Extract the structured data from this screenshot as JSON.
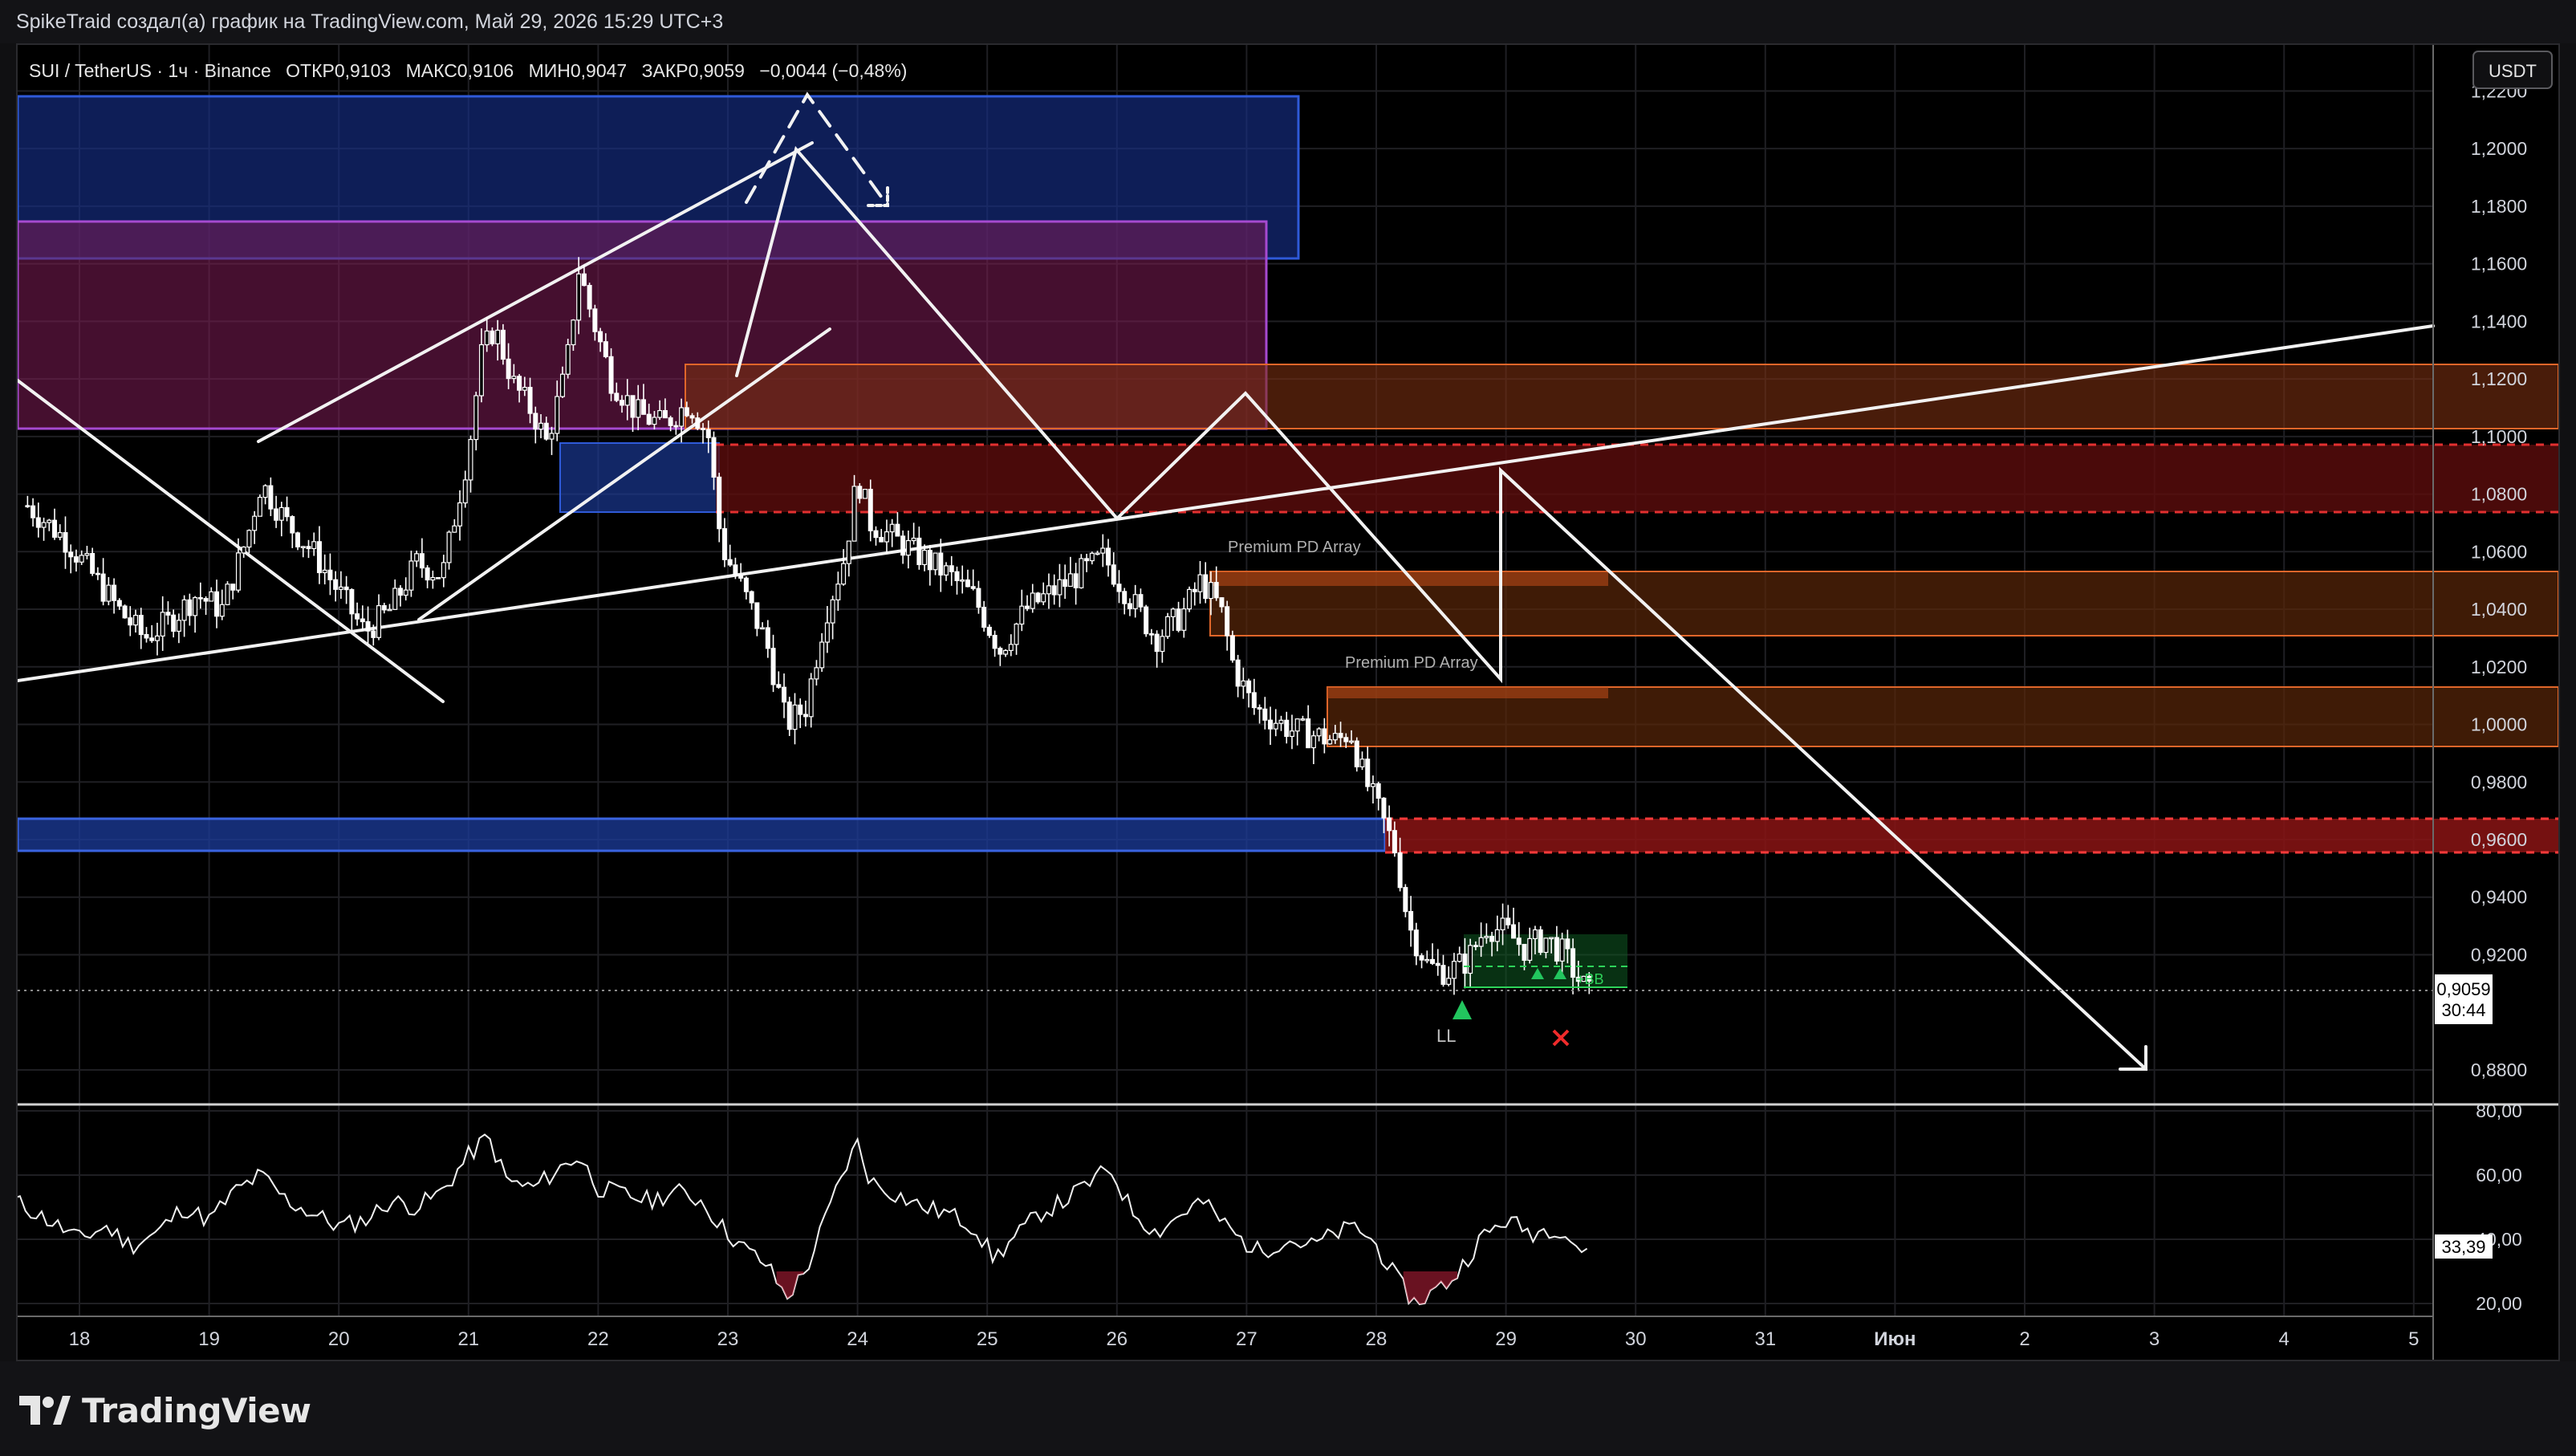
{
  "topbar": {
    "text": "SpikeTraid создал(а) график на TradingView.com, Май 29, 2026 15:29 UTC+3"
  },
  "legend": {
    "symbol": "SUI / TetherUS · 1ч · Binance",
    "open": "ОТКР0,9103",
    "high": "МАКС0,9106",
    "low": "МИН0,9047",
    "close": "ЗАКР0,9059",
    "change": "−0,0044 (−0,48%)"
  },
  "currency_button": "USDT",
  "price_badge": {
    "price": "0,9059",
    "countdown": "30:44"
  },
  "rsi_badge": "33,39",
  "footer": {
    "logo_text": "TradingView"
  },
  "colors": {
    "background": "#000000",
    "grid": "#1f1f23",
    "candle": "#ffffff",
    "blue_zone": "#2850d0",
    "purple_zone": "#9b3dd6",
    "orange_zone": "#f07030",
    "red_zone": "#d01e1e",
    "green_zone": "#1e8c3c",
    "signal_up": "#22c55e",
    "signal_x": "#ef2b2b"
  },
  "annotations": {
    "premium_1": "Premium PD Array",
    "premium_2": "Premium PD Array",
    "ll_label": "LL",
    "bb_label": "+BB"
  },
  "chart_data": [
    {
      "type": "candlestick",
      "title": "SUI / TetherUS · 1ч · Binance",
      "x_ticks": [
        "18",
        "19",
        "20",
        "21",
        "22",
        "23",
        "24",
        "25",
        "26",
        "27",
        "28",
        "29",
        "30",
        "31",
        "Июн",
        "2",
        "3",
        "4",
        "5"
      ],
      "y_ticks": [
        "1,2200",
        "1,2000",
        "1,1800",
        "1,1600",
        "1,1400",
        "1,1200",
        "1,1000",
        "1,0800",
        "1,0600",
        "1,0400",
        "1,0200",
        "1,0000",
        "0,9800",
        "0,9600",
        "0,9400",
        "0,9200",
        "0,8800"
      ],
      "ylim": [
        0.868,
        1.236
      ],
      "last_price": 0.9059,
      "grid": true,
      "close_path": [
        [
          17.6,
          1.076
        ],
        [
          17.9,
          1.064
        ],
        [
          18.1,
          1.052
        ],
        [
          18.3,
          1.04
        ],
        [
          18.5,
          1.03
        ],
        [
          18.7,
          1.036
        ],
        [
          18.9,
          1.045
        ],
        [
          19.1,
          1.04
        ],
        [
          19.3,
          1.066
        ],
        [
          19.4,
          1.084
        ],
        [
          19.6,
          1.07
        ],
        [
          19.8,
          1.06
        ],
        [
          20.0,
          1.046
        ],
        [
          20.2,
          1.032
        ],
        [
          20.4,
          1.04
        ],
        [
          20.6,
          1.056
        ],
        [
          20.8,
          1.052
        ],
        [
          21.0,
          1.095
        ],
        [
          21.1,
          1.128
        ],
        [
          21.2,
          1.138
        ],
        [
          21.35,
          1.118
        ],
        [
          21.5,
          1.108
        ],
        [
          21.6,
          1.098
        ],
        [
          21.75,
          1.122
        ],
        [
          21.85,
          1.158
        ],
        [
          21.95,
          1.142
        ],
        [
          22.1,
          1.12
        ],
        [
          22.3,
          1.108
        ],
        [
          22.5,
          1.104
        ],
        [
          22.7,
          1.112
        ],
        [
          22.85,
          1.1
        ],
        [
          22.95,
          1.062
        ],
        [
          23.1,
          1.048
        ],
        [
          23.3,
          1.028
        ],
        [
          23.45,
          1.0
        ],
        [
          23.6,
          1.006
        ],
        [
          23.75,
          1.038
        ],
        [
          23.9,
          1.058
        ],
        [
          24.0,
          1.086
        ],
        [
          24.1,
          1.07
        ],
        [
          24.3,
          1.064
        ],
        [
          24.5,
          1.058
        ],
        [
          24.7,
          1.052
        ],
        [
          24.9,
          1.044
        ],
        [
          25.1,
          1.026
        ],
        [
          25.3,
          1.04
        ],
        [
          25.5,
          1.046
        ],
        [
          25.7,
          1.052
        ],
        [
          25.9,
          1.058
        ],
        [
          26.1,
          1.044
        ],
        [
          26.3,
          1.03
        ],
        [
          26.5,
          1.038
        ],
        [
          26.65,
          1.05
        ],
        [
          26.8,
          1.04
        ],
        [
          26.9,
          1.02
        ],
        [
          27.05,
          1.006
        ],
        [
          27.2,
          1.002
        ],
        [
          27.35,
          0.998
        ],
        [
          27.55,
          0.996
        ],
        [
          27.7,
          0.994
        ],
        [
          27.8,
          0.998
        ],
        [
          27.9,
          0.982
        ],
        [
          28.0,
          0.972
        ],
        [
          28.15,
          0.956
        ],
        [
          28.25,
          0.93
        ],
        [
          28.4,
          0.916
        ],
        [
          28.55,
          0.914
        ],
        [
          28.7,
          0.918
        ],
        [
          28.85,
          0.93
        ],
        [
          29.0,
          0.928
        ],
        [
          29.15,
          0.922
        ],
        [
          29.3,
          0.926
        ],
        [
          29.45,
          0.92
        ],
        [
          29.55,
          0.912
        ],
        [
          29.65,
          0.906
        ]
      ]
    },
    {
      "type": "line",
      "title": "RSI",
      "y_ticks": [
        "80,00",
        "60,00",
        "40,00",
        "20,00"
      ],
      "ylim": [
        16,
        82
      ],
      "last_value": 33.39,
      "values_path": [
        [
          17.5,
          52
        ],
        [
          17.8,
          45
        ],
        [
          18.0,
          40
        ],
        [
          18.2,
          44
        ],
        [
          18.4,
          38
        ],
        [
          18.6,
          42
        ],
        [
          18.8,
          50
        ],
        [
          19.0,
          46
        ],
        [
          19.2,
          55
        ],
        [
          19.4,
          60
        ],
        [
          19.6,
          52
        ],
        [
          19.8,
          48
        ],
        [
          20.0,
          44
        ],
        [
          20.2,
          46
        ],
        [
          20.4,
          52
        ],
        [
          20.6,
          50
        ],
        [
          20.8,
          55
        ],
        [
          21.0,
          66
        ],
        [
          21.15,
          72
        ],
        [
          21.3,
          58
        ],
        [
          21.5,
          56
        ],
        [
          21.7,
          62
        ],
        [
          21.85,
          66
        ],
        [
          22.0,
          56
        ],
        [
          22.2,
          54
        ],
        [
          22.4,
          52
        ],
        [
          22.6,
          55
        ],
        [
          22.8,
          52
        ],
        [
          22.95,
          44
        ],
        [
          23.1,
          38
        ],
        [
          23.3,
          32
        ],
        [
          23.45,
          22
        ],
        [
          23.6,
          30
        ],
        [
          23.75,
          46
        ],
        [
          23.9,
          62
        ],
        [
          24.0,
          70
        ],
        [
          24.1,
          58
        ],
        [
          24.3,
          54
        ],
        [
          24.5,
          50
        ],
        [
          24.7,
          48
        ],
        [
          24.9,
          44
        ],
        [
          25.05,
          34
        ],
        [
          25.2,
          40
        ],
        [
          25.4,
          48
        ],
        [
          25.6,
          52
        ],
        [
          25.8,
          58
        ],
        [
          25.95,
          62
        ],
        [
          26.1,
          50
        ],
        [
          26.3,
          42
        ],
        [
          26.5,
          48
        ],
        [
          26.65,
          52
        ],
        [
          26.8,
          46
        ],
        [
          26.95,
          40
        ],
        [
          27.1,
          36
        ],
        [
          27.3,
          40
        ],
        [
          27.5,
          38
        ],
        [
          27.7,
          42
        ],
        [
          27.85,
          44
        ],
        [
          28.0,
          38
        ],
        [
          28.15,
          28
        ],
        [
          28.3,
          20
        ],
        [
          28.45,
          24
        ],
        [
          28.6,
          28
        ],
        [
          28.8,
          40
        ],
        [
          29.0,
          46
        ],
        [
          29.2,
          42
        ],
        [
          29.4,
          44
        ],
        [
          29.55,
          38
        ],
        [
          29.65,
          33.39
        ]
      ]
    }
  ]
}
